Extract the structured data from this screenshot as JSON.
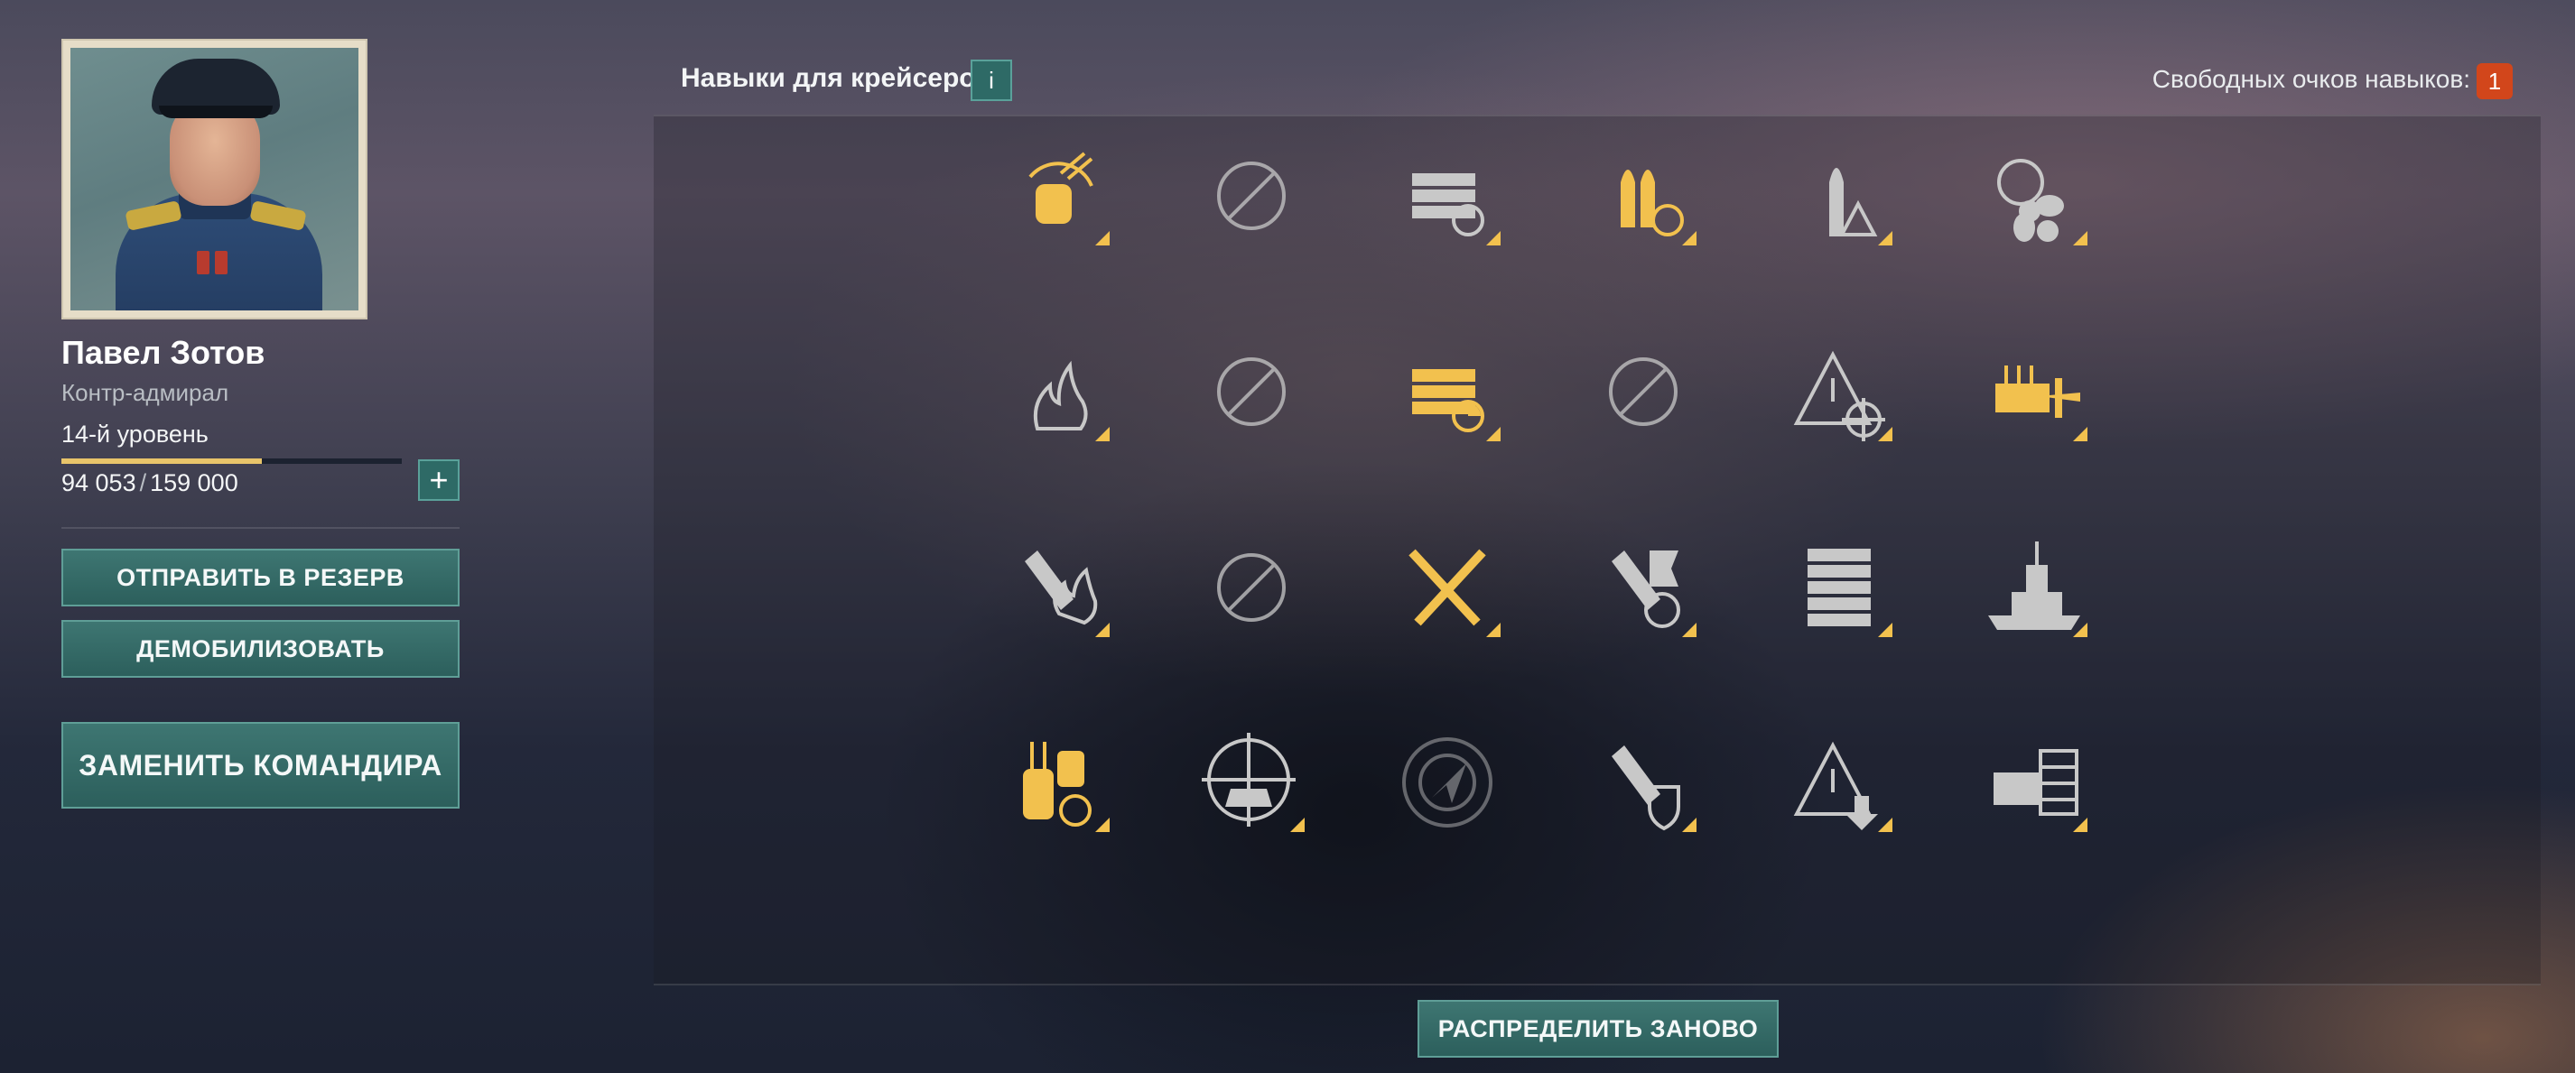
{
  "commander": {
    "name": "Павел Зотов",
    "rank": "Контр-адмирал",
    "level": "14-й уровень",
    "xp_current": "94 053",
    "xp_separator": "/",
    "xp_total": "159 000",
    "xp_progress": 0.59
  },
  "buttons": {
    "add_xp": "+",
    "reserve": "ОТПРАВИТЬ В РЕЗЕРВ",
    "demobilize": "ДЕМОБИЛИЗОВАТЬ",
    "replace": "ЗАМЕНИТЬ КОМАНДИРА",
    "redistribute": "РАСПРЕДЕЛИТЬ ЗАНОВО",
    "info": "i"
  },
  "header": {
    "title": "Навыки для крейсеров",
    "free_points_label": "Свободных очков навыков:",
    "free_points_value": "1"
  },
  "colors": {
    "accent_teal": "#2e6a66",
    "learned_gold": "#f2c14e",
    "unlearned_gray": "#c8c8c8",
    "badge_orange": "#d2461b"
  },
  "skills": [
    {
      "icon": "rotating-turret-icon",
      "state": "learned"
    },
    {
      "icon": "disabled-skill-icon",
      "state": "unavailable"
    },
    {
      "icon": "reload-rack-icon",
      "state": "available"
    },
    {
      "icon": "shells-reload-icon",
      "state": "learned"
    },
    {
      "icon": "shell-warning-icon",
      "state": "available"
    },
    {
      "icon": "propeller-helm-icon",
      "state": "available"
    },
    {
      "icon": "fire-icon",
      "state": "available"
    },
    {
      "icon": "disabled-skill-icon",
      "state": "unavailable"
    },
    {
      "icon": "rack-timer-icon",
      "state": "learned"
    },
    {
      "icon": "disabled-skill-icon",
      "state": "unavailable"
    },
    {
      "icon": "warning-crosshair-icon",
      "state": "available"
    },
    {
      "icon": "aa-gun-plane-icon",
      "state": "learned"
    },
    {
      "icon": "fire-shell-icon",
      "state": "available"
    },
    {
      "icon": "disabled-skill-icon",
      "state": "unavailable"
    },
    {
      "icon": "crossed-torpedoes-icon",
      "state": "learned"
    },
    {
      "icon": "shell-flag-icon",
      "state": "available"
    },
    {
      "icon": "rack-stack-icon",
      "state": "available"
    },
    {
      "icon": "battleship-icon",
      "state": "available"
    },
    {
      "icon": "turrets-reload-icon",
      "state": "learned"
    },
    {
      "icon": "ship-crosshair-icon",
      "state": "available"
    },
    {
      "icon": "radar-compass-icon",
      "state": "locked"
    },
    {
      "icon": "fire-shield-icon",
      "state": "available"
    },
    {
      "icon": "warning-down-icon",
      "state": "available"
    },
    {
      "icon": "gun-mount-icon",
      "state": "available"
    }
  ]
}
